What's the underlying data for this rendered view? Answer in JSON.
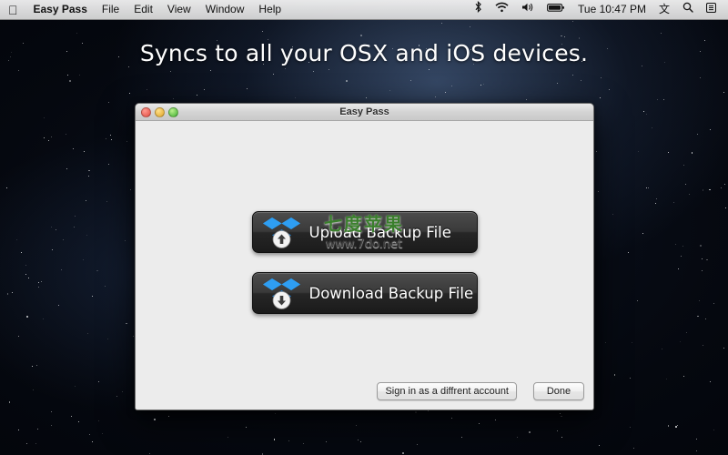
{
  "menubar": {
    "apple_icon": "apple-logo",
    "items": [
      {
        "label": "Easy Pass",
        "bold": true
      },
      {
        "label": "File",
        "bold": false
      },
      {
        "label": "Edit",
        "bold": false
      },
      {
        "label": "View",
        "bold": false
      },
      {
        "label": "Window",
        "bold": false
      },
      {
        "label": "Help",
        "bold": false
      }
    ],
    "status_icons": [
      {
        "name": "bluetooth-icon",
        "glyph": "ᛦ"
      },
      {
        "name": "wifi-icon",
        "glyph": "◠"
      },
      {
        "name": "volume-icon",
        "glyph": "◀"
      },
      {
        "name": "battery-icon",
        "glyph": "▭"
      }
    ],
    "clock": "Tue 10:47 PM",
    "input_menu": "文",
    "spotlight_icon": "search-icon",
    "notification_icon": "list-icon"
  },
  "headline": "Syncs to all your OSX and iOS devices.",
  "window": {
    "title": "Easy Pass",
    "traffic_lights": [
      "close-button",
      "minimize-button",
      "zoom-button"
    ],
    "upload_button": "Upload Backup File",
    "download_button": "Download Backup File",
    "signin_button": "Sign in as a diffrent account",
    "done_button": "Done"
  },
  "watermark": {
    "chinese": "七度苹果",
    "url": "www.7do.net"
  },
  "colors": {
    "dropbox_blue": "#1a8cff",
    "button_dark": "#2b2b2b",
    "window_bg": "#ececec",
    "watermark_green": "#3a7f2c"
  }
}
